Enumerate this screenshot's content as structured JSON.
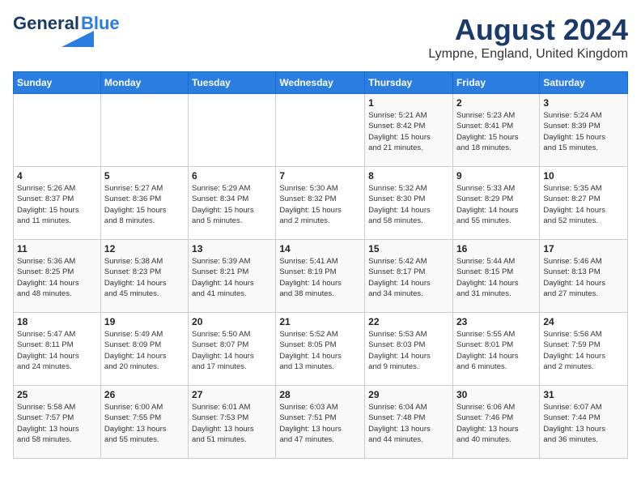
{
  "header": {
    "logo_general": "General",
    "logo_blue": "Blue",
    "month_title": "August 2024",
    "location": "Lympne, England, United Kingdom"
  },
  "days_of_week": [
    "Sunday",
    "Monday",
    "Tuesday",
    "Wednesday",
    "Thursday",
    "Friday",
    "Saturday"
  ],
  "weeks": [
    [
      {
        "day": "",
        "detail": ""
      },
      {
        "day": "",
        "detail": ""
      },
      {
        "day": "",
        "detail": ""
      },
      {
        "day": "",
        "detail": ""
      },
      {
        "day": "1",
        "detail": "Sunrise: 5:21 AM\nSunset: 8:42 PM\nDaylight: 15 hours\nand 21 minutes."
      },
      {
        "day": "2",
        "detail": "Sunrise: 5:23 AM\nSunset: 8:41 PM\nDaylight: 15 hours\nand 18 minutes."
      },
      {
        "day": "3",
        "detail": "Sunrise: 5:24 AM\nSunset: 8:39 PM\nDaylight: 15 hours\nand 15 minutes."
      }
    ],
    [
      {
        "day": "4",
        "detail": "Sunrise: 5:26 AM\nSunset: 8:37 PM\nDaylight: 15 hours\nand 11 minutes."
      },
      {
        "day": "5",
        "detail": "Sunrise: 5:27 AM\nSunset: 8:36 PM\nDaylight: 15 hours\nand 8 minutes."
      },
      {
        "day": "6",
        "detail": "Sunrise: 5:29 AM\nSunset: 8:34 PM\nDaylight: 15 hours\nand 5 minutes."
      },
      {
        "day": "7",
        "detail": "Sunrise: 5:30 AM\nSunset: 8:32 PM\nDaylight: 15 hours\nand 2 minutes."
      },
      {
        "day": "8",
        "detail": "Sunrise: 5:32 AM\nSunset: 8:30 PM\nDaylight: 14 hours\nand 58 minutes."
      },
      {
        "day": "9",
        "detail": "Sunrise: 5:33 AM\nSunset: 8:29 PM\nDaylight: 14 hours\nand 55 minutes."
      },
      {
        "day": "10",
        "detail": "Sunrise: 5:35 AM\nSunset: 8:27 PM\nDaylight: 14 hours\nand 52 minutes."
      }
    ],
    [
      {
        "day": "11",
        "detail": "Sunrise: 5:36 AM\nSunset: 8:25 PM\nDaylight: 14 hours\nand 48 minutes."
      },
      {
        "day": "12",
        "detail": "Sunrise: 5:38 AM\nSunset: 8:23 PM\nDaylight: 14 hours\nand 45 minutes."
      },
      {
        "day": "13",
        "detail": "Sunrise: 5:39 AM\nSunset: 8:21 PM\nDaylight: 14 hours\nand 41 minutes."
      },
      {
        "day": "14",
        "detail": "Sunrise: 5:41 AM\nSunset: 8:19 PM\nDaylight: 14 hours\nand 38 minutes."
      },
      {
        "day": "15",
        "detail": "Sunrise: 5:42 AM\nSunset: 8:17 PM\nDaylight: 14 hours\nand 34 minutes."
      },
      {
        "day": "16",
        "detail": "Sunrise: 5:44 AM\nSunset: 8:15 PM\nDaylight: 14 hours\nand 31 minutes."
      },
      {
        "day": "17",
        "detail": "Sunrise: 5:46 AM\nSunset: 8:13 PM\nDaylight: 14 hours\nand 27 minutes."
      }
    ],
    [
      {
        "day": "18",
        "detail": "Sunrise: 5:47 AM\nSunset: 8:11 PM\nDaylight: 14 hours\nand 24 minutes."
      },
      {
        "day": "19",
        "detail": "Sunrise: 5:49 AM\nSunset: 8:09 PM\nDaylight: 14 hours\nand 20 minutes."
      },
      {
        "day": "20",
        "detail": "Sunrise: 5:50 AM\nSunset: 8:07 PM\nDaylight: 14 hours\nand 17 minutes."
      },
      {
        "day": "21",
        "detail": "Sunrise: 5:52 AM\nSunset: 8:05 PM\nDaylight: 14 hours\nand 13 minutes."
      },
      {
        "day": "22",
        "detail": "Sunrise: 5:53 AM\nSunset: 8:03 PM\nDaylight: 14 hours\nand 9 minutes."
      },
      {
        "day": "23",
        "detail": "Sunrise: 5:55 AM\nSunset: 8:01 PM\nDaylight: 14 hours\nand 6 minutes."
      },
      {
        "day": "24",
        "detail": "Sunrise: 5:56 AM\nSunset: 7:59 PM\nDaylight: 14 hours\nand 2 minutes."
      }
    ],
    [
      {
        "day": "25",
        "detail": "Sunrise: 5:58 AM\nSunset: 7:57 PM\nDaylight: 13 hours\nand 58 minutes."
      },
      {
        "day": "26",
        "detail": "Sunrise: 6:00 AM\nSunset: 7:55 PM\nDaylight: 13 hours\nand 55 minutes."
      },
      {
        "day": "27",
        "detail": "Sunrise: 6:01 AM\nSunset: 7:53 PM\nDaylight: 13 hours\nand 51 minutes."
      },
      {
        "day": "28",
        "detail": "Sunrise: 6:03 AM\nSunset: 7:51 PM\nDaylight: 13 hours\nand 47 minutes."
      },
      {
        "day": "29",
        "detail": "Sunrise: 6:04 AM\nSunset: 7:48 PM\nDaylight: 13 hours\nand 44 minutes."
      },
      {
        "day": "30",
        "detail": "Sunrise: 6:06 AM\nSunset: 7:46 PM\nDaylight: 13 hours\nand 40 minutes."
      },
      {
        "day": "31",
        "detail": "Sunrise: 6:07 AM\nSunset: 7:44 PM\nDaylight: 13 hours\nand 36 minutes."
      }
    ]
  ]
}
